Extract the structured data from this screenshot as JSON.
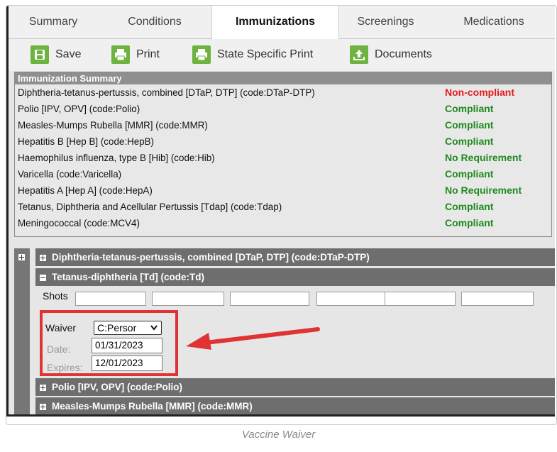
{
  "tabs": [
    {
      "label": "Summary"
    },
    {
      "label": "Conditions"
    },
    {
      "label": "Immunizations"
    },
    {
      "label": "Screenings"
    },
    {
      "label": "Medications"
    }
  ],
  "toolbar": {
    "save": "Save",
    "print": "Print",
    "state_print": "State Specific Print",
    "documents": "Documents"
  },
  "summary": {
    "header": "Immunization Summary",
    "rows": [
      {
        "name": "Diphtheria-tetanus-pertussis, combined [DTaP, DTP] (code:DTaP-DTP)",
        "status": "Non-compliant"
      },
      {
        "name": "Polio [IPV, OPV] (code:Polio)",
        "status": "Compliant"
      },
      {
        "name": "Measles-Mumps Rubella [MMR] (code:MMR)",
        "status": "Compliant"
      },
      {
        "name": "Hepatitis B [Hep B] (code:HepB)",
        "status": "Compliant"
      },
      {
        "name": "Haemophilus influenza, type B [Hib] (code:Hib)",
        "status": "No Requirement"
      },
      {
        "name": "Varicella (code:Varicella)",
        "status": "Compliant"
      },
      {
        "name": "Hepatitis A [Hep A] (code:HepA)",
        "status": "No Requirement"
      },
      {
        "name": "Tetanus, Diphtheria and Acellular Pertussis [Tdap] (code:Tdap)",
        "status": "Compliant"
      },
      {
        "name": "Meningococcal (code:MCV4)",
        "status": "Compliant"
      }
    ]
  },
  "groups": {
    "dtap": "Diphtheria-tetanus-pertussis, combined [DTaP, DTP] (code:DTaP-DTP)",
    "td": "Tetanus-diphtheria [Td] (code:Td)",
    "polio": "Polio [IPV, OPV] (code:Polio)",
    "mmr": "Measles-Mumps Rubella [MMR] (code:MMR)"
  },
  "td_detail": {
    "shots_label": "Shots",
    "waiver_label": "Waiver",
    "waiver_value": "C:Persor",
    "date_label": "Date:",
    "date_value": "01/31/2023",
    "expires_label": "Expires:",
    "expires_value": "12/01/2023"
  },
  "caption": "Vaccine Waiver",
  "colors": {
    "compliant": "#1f8a1f",
    "non_compliant": "#e21b1b",
    "highlight": "#e03434",
    "toolbar_icon": "#6db33f"
  }
}
